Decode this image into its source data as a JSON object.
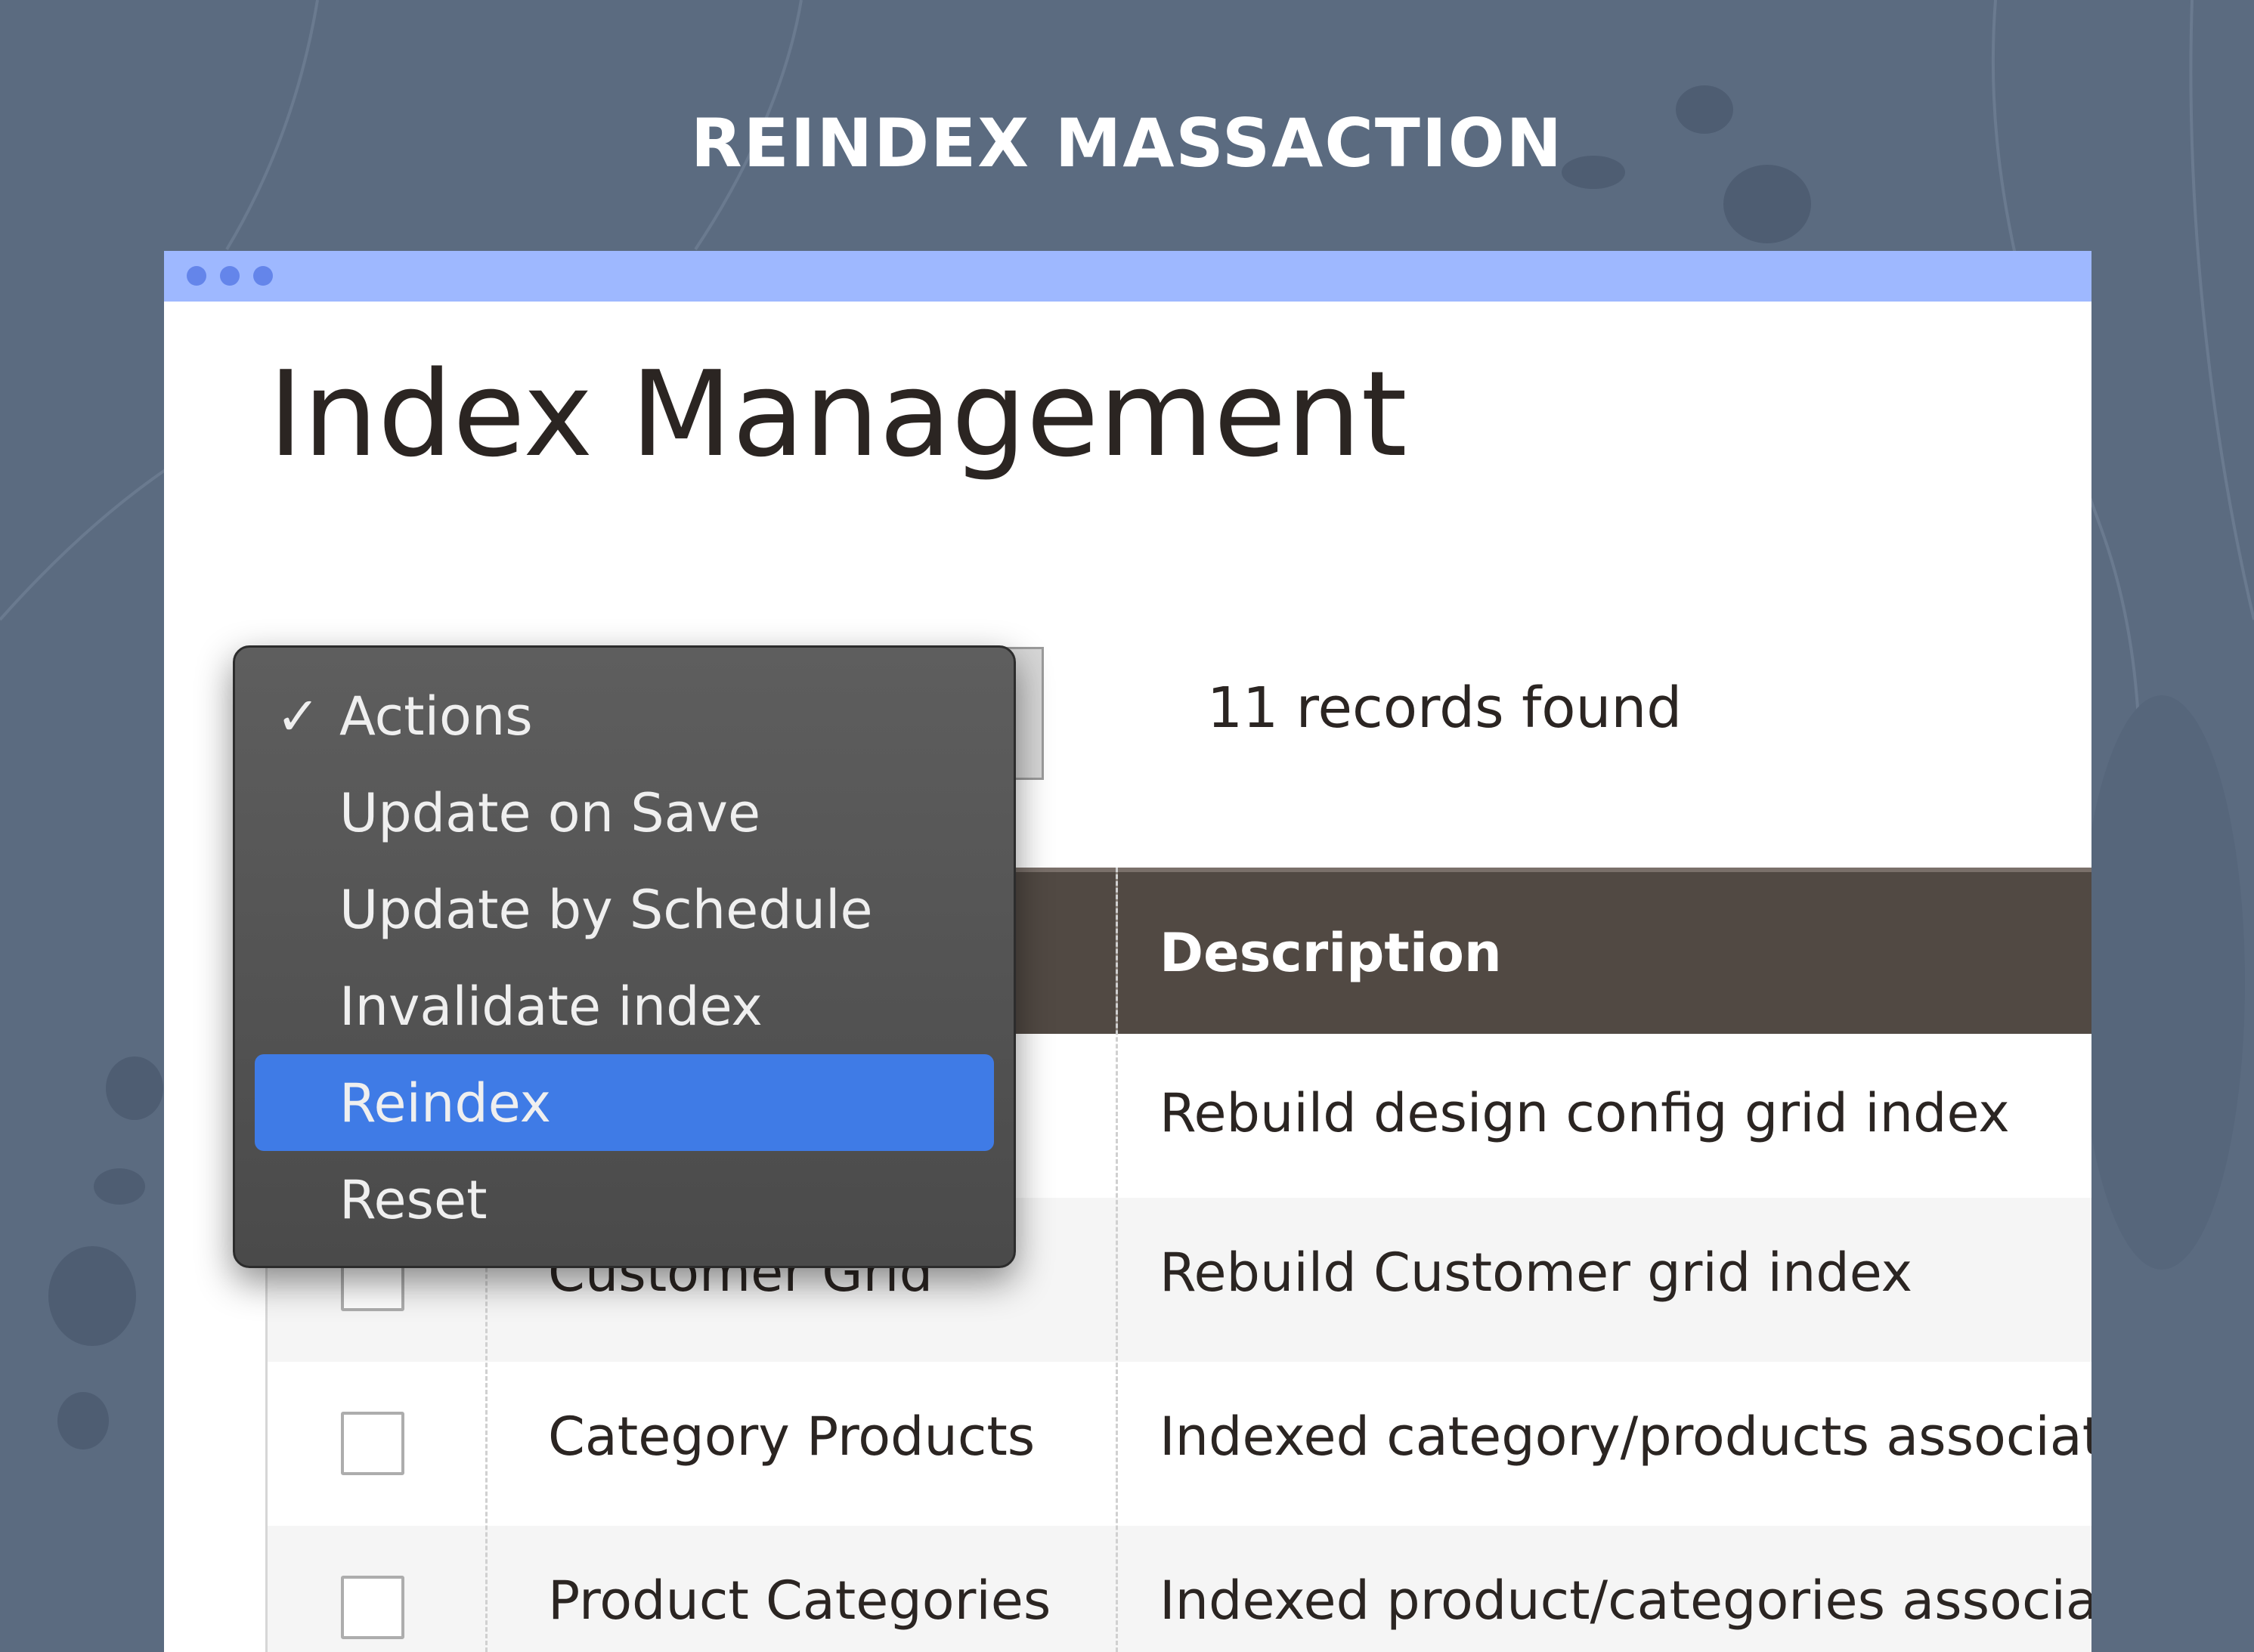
{
  "banner": {
    "title": "REINDEX MASSACTION"
  },
  "window": {
    "dots": [
      "dot",
      "dot",
      "dot"
    ]
  },
  "page": {
    "title": "Index Management"
  },
  "records_found": "11 records found",
  "grid": {
    "header": {
      "description": "Description"
    },
    "rows": [
      {
        "checked": false,
        "title": "",
        "description": "Rebuild design config grid index"
      },
      {
        "checked": false,
        "title": "Customer Grid",
        "description": "Rebuild Customer grid index"
      },
      {
        "checked": false,
        "title": "Category Products",
        "description": "Indexed category/products associatio"
      },
      {
        "checked": false,
        "title": "Product Categories",
        "description": "Indexed product/categories associati"
      }
    ]
  },
  "actions_menu": {
    "items": [
      {
        "label": "Actions",
        "checkmark": "✓",
        "selected": false
      },
      {
        "label": "Update on Save",
        "selected": false
      },
      {
        "label": "Update by Schedule",
        "selected": false
      },
      {
        "label": "Invalidate index",
        "selected": false
      },
      {
        "label": "Reindex",
        "selected": true
      },
      {
        "label": "Reset",
        "selected": false
      }
    ]
  },
  "colors": {
    "background": "#5b6b80",
    "titlebar": "#9eb8ff",
    "titlebar_dots": "#6485ea",
    "grid_header": "#514943",
    "menu_bg": "#4f4f4f",
    "menu_selected": "#3f7be6"
  }
}
